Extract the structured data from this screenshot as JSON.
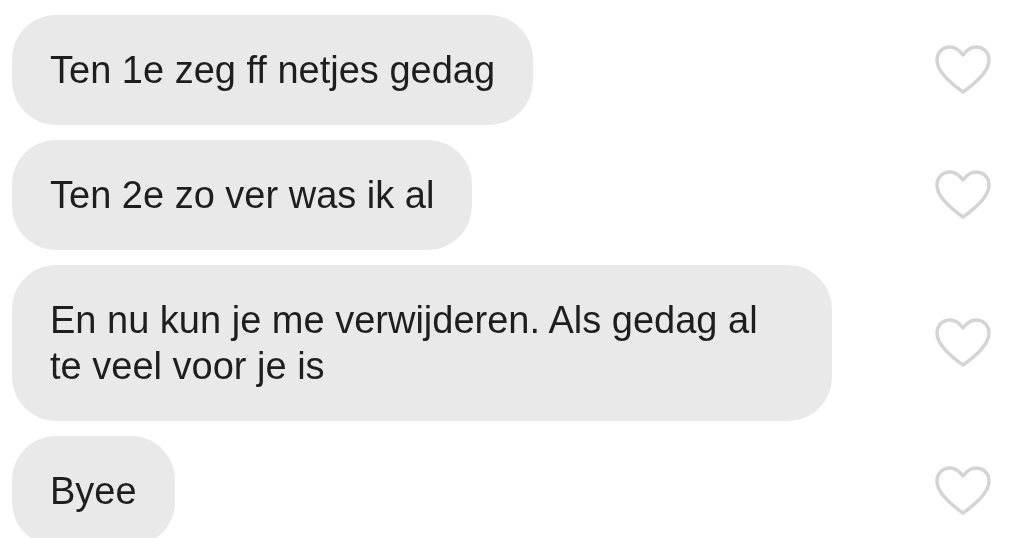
{
  "messages": [
    {
      "text": "Ten 1e zeg ff netjes gedag",
      "liked": false
    },
    {
      "text": "Ten 2e zo ver was ik al",
      "liked": false
    },
    {
      "text": "En nu kun je me verwijderen. Als gedag al te veel voor je is",
      "liked": false
    },
    {
      "text": "Byee",
      "liked": false
    }
  ]
}
